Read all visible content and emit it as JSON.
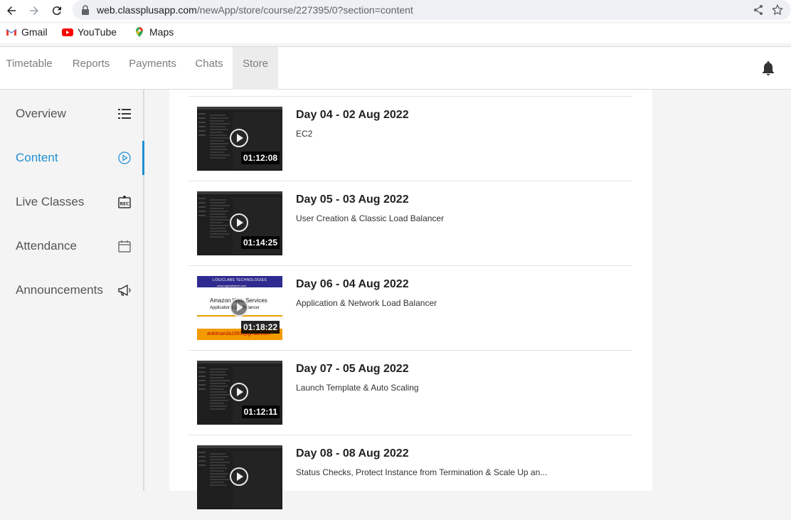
{
  "browser": {
    "url_host": "web.classplusapp.com",
    "url_path": "/newApp/store/course/227395/0?section=content",
    "bookmarks": [
      "Gmail",
      "YouTube",
      "Maps"
    ]
  },
  "header": {
    "tabs": [
      {
        "label": "Timetable"
      },
      {
        "label": "Reports"
      },
      {
        "label": "Payments"
      },
      {
        "label": "Chats"
      },
      {
        "label": "Store"
      }
    ],
    "active_tab": "Store"
  },
  "sidebar": {
    "items": [
      {
        "label": "Overview",
        "icon": "list-icon"
      },
      {
        "label": "Content",
        "icon": "play-circle-icon"
      },
      {
        "label": "Live Classes",
        "icon": "rec-icon"
      },
      {
        "label": "Attendance",
        "icon": "calendar-icon"
      },
      {
        "label": "Announcements",
        "icon": "megaphone-icon"
      }
    ],
    "active_item": "Content"
  },
  "content": {
    "videos": [
      {
        "title": "Day 04 - 02 Aug 2022",
        "subtitle": "EC2",
        "duration": "01:12:08"
      },
      {
        "title": "Day 05 - 03 Aug 2022",
        "subtitle": "User Creation & Classic Load Balancer",
        "duration": "01:14:25"
      },
      {
        "title": "Day 06 - 04 Aug 2022",
        "subtitle": "Application & Network Load Balancer",
        "duration": "01:18:22",
        "thumb": {
          "t1": "Amazon Web Services",
          "t2": "Application Load Balancer",
          "footer": "ankitnarula1991@gmail.com",
          "header": "LOGICLABS TECHNOLOGIES",
          "site": "www.logiclabstech.com"
        }
      },
      {
        "title": "Day 07 - 05 Aug 2022",
        "subtitle": "Launch Template & Auto Scaling",
        "duration": "01:12:11"
      },
      {
        "title": "Day 08 - 08 Aug 2022",
        "subtitle": "Status Checks, Protect Instance from Termination & Scale Up an..."
      }
    ]
  },
  "colors": {
    "accent": "#1f8fd1",
    "tab_active_bg": "#ececec"
  }
}
